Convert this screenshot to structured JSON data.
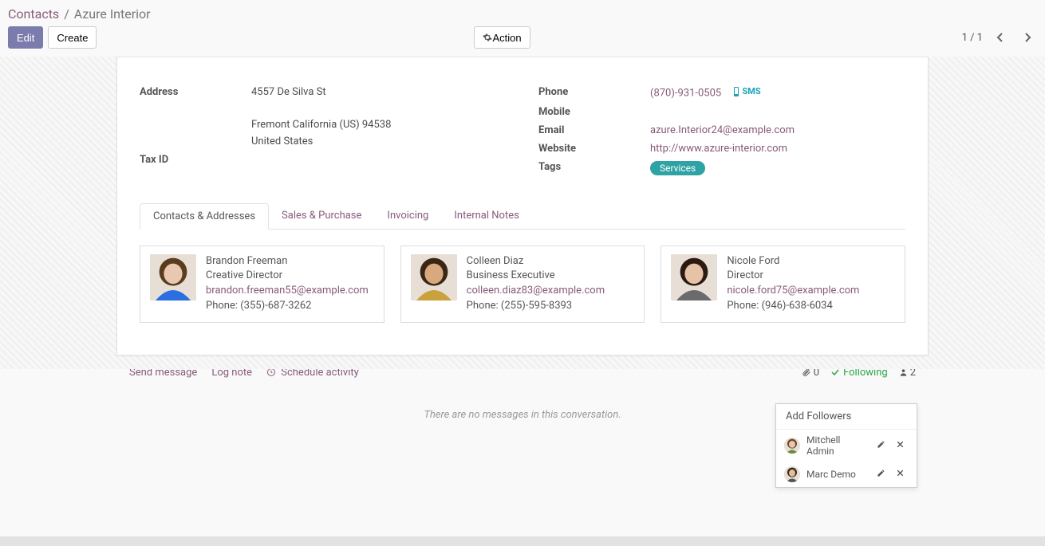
{
  "breadcrumb": {
    "root": "Contacts",
    "current": "Azure Interior"
  },
  "toolbar": {
    "edit": "Edit",
    "create": "Create",
    "action": "Action"
  },
  "pager": {
    "text": "1 / 1"
  },
  "info": {
    "left": {
      "address_label": "Address",
      "street": "4557 De Silva St",
      "city_line": "Fremont  California (US)  94538",
      "country": "United States",
      "tax_label": "Tax ID"
    },
    "right": {
      "phone_label": "Phone",
      "phone_value": "(870)-931-0505",
      "sms_label": "SMS",
      "mobile_label": "Mobile",
      "email_label": "Email",
      "email_value": "azure.Interior24@example.com",
      "website_label": "Website",
      "website_value": "http://www.azure-interior.com",
      "tags_label": "Tags",
      "tag_chip": "Services"
    }
  },
  "tabs": [
    {
      "label": "Contacts & Addresses"
    },
    {
      "label": "Sales & Purchase"
    },
    {
      "label": "Invoicing"
    },
    {
      "label": "Internal Notes"
    }
  ],
  "contacts": [
    {
      "avatar": {
        "skin": "#e8c8b0",
        "hair": "#5a3b1e",
        "shirt": "#2b6fe0"
      },
      "name": "Brandon Freeman",
      "title": "Creative Director",
      "email": "brandon.freeman55@example.com",
      "phone": "Phone: (355)-687-3262"
    },
    {
      "avatar": {
        "skin": "#d8a97f",
        "hair": "#3b2514",
        "shirt": "#c9a23d"
      },
      "name": "Colleen Diaz",
      "title": "Business Executive",
      "email": "colleen.diaz83@example.com",
      "phone": "Phone: (255)-595-8393"
    },
    {
      "avatar": {
        "skin": "#e6c3a6",
        "hair": "#2b1a12",
        "shirt": "#6b6b6b"
      },
      "name": "Nicole Ford",
      "title": "Director",
      "email": "nicole.ford75@example.com",
      "phone": "Phone: (946)-638-6034"
    }
  ],
  "chatter": {
    "send": "Send message",
    "log": "Log note",
    "schedule": "Schedule activity",
    "attach_count": "0",
    "following": "Following",
    "follower_count": "2",
    "empty": "There are no messages in this conversation."
  },
  "followers_popover": {
    "header": "Add Followers",
    "rows": [
      {
        "avatar": {
          "skin": "#e8c8b0",
          "hair": "#6b4a2a",
          "shirt": "#6a8a3a"
        },
        "name": "Mitchell Admin"
      },
      {
        "avatar": {
          "skin": "#e2bfa0",
          "hair": "#3a2614",
          "shirt": "#555555"
        },
        "name": "Marc Demo"
      }
    ]
  }
}
